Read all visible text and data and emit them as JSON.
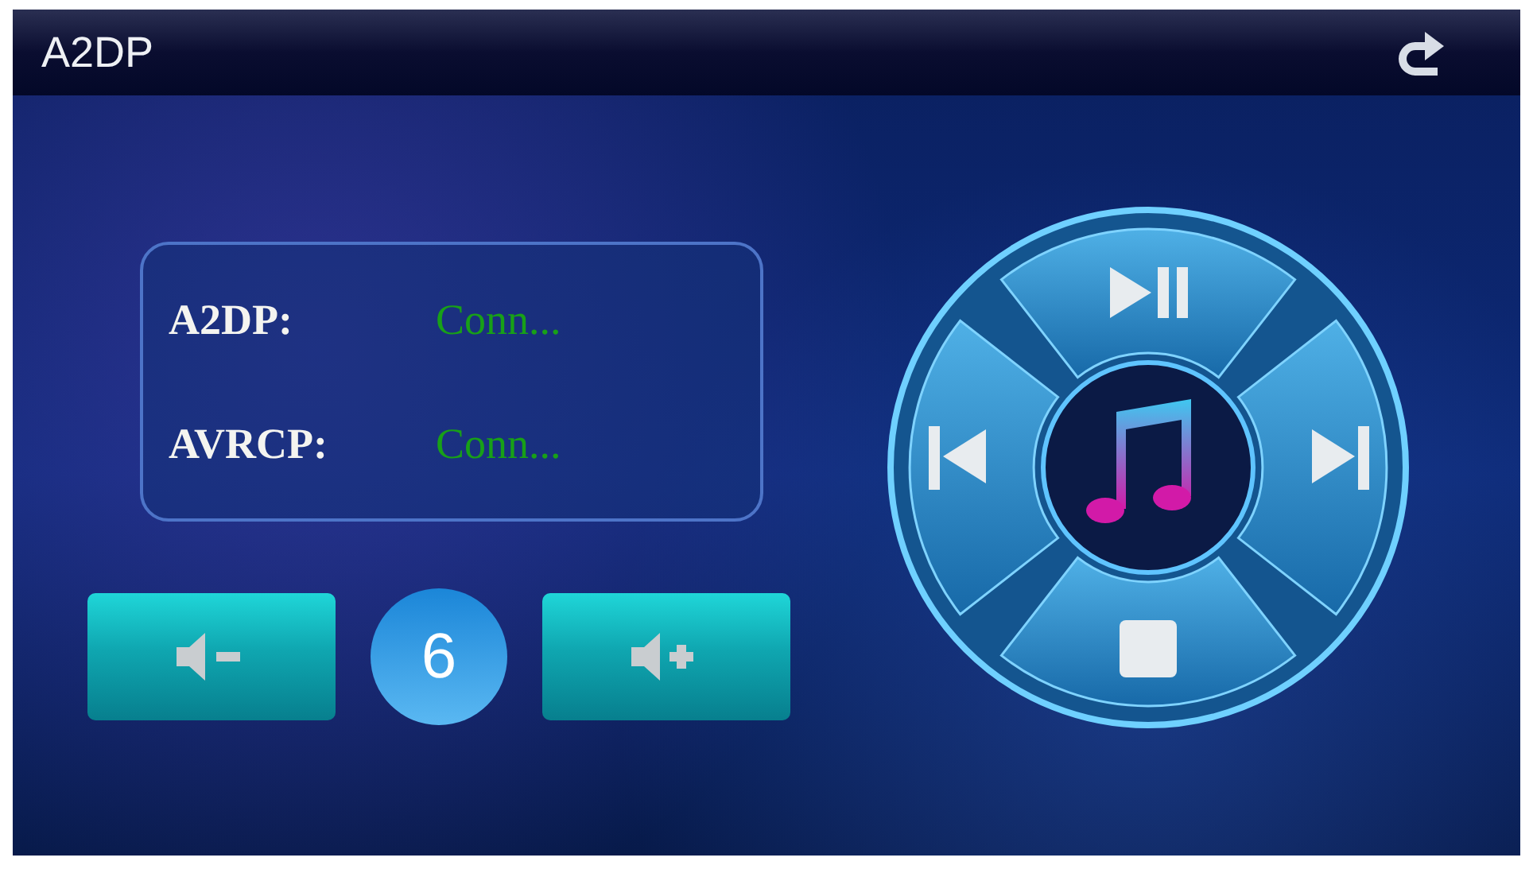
{
  "title": "A2DP",
  "status": [
    {
      "label": "A2DP:",
      "value": "Conn..."
    },
    {
      "label": "AVRCP:",
      "value": "Conn..."
    }
  ],
  "volume": "6"
}
